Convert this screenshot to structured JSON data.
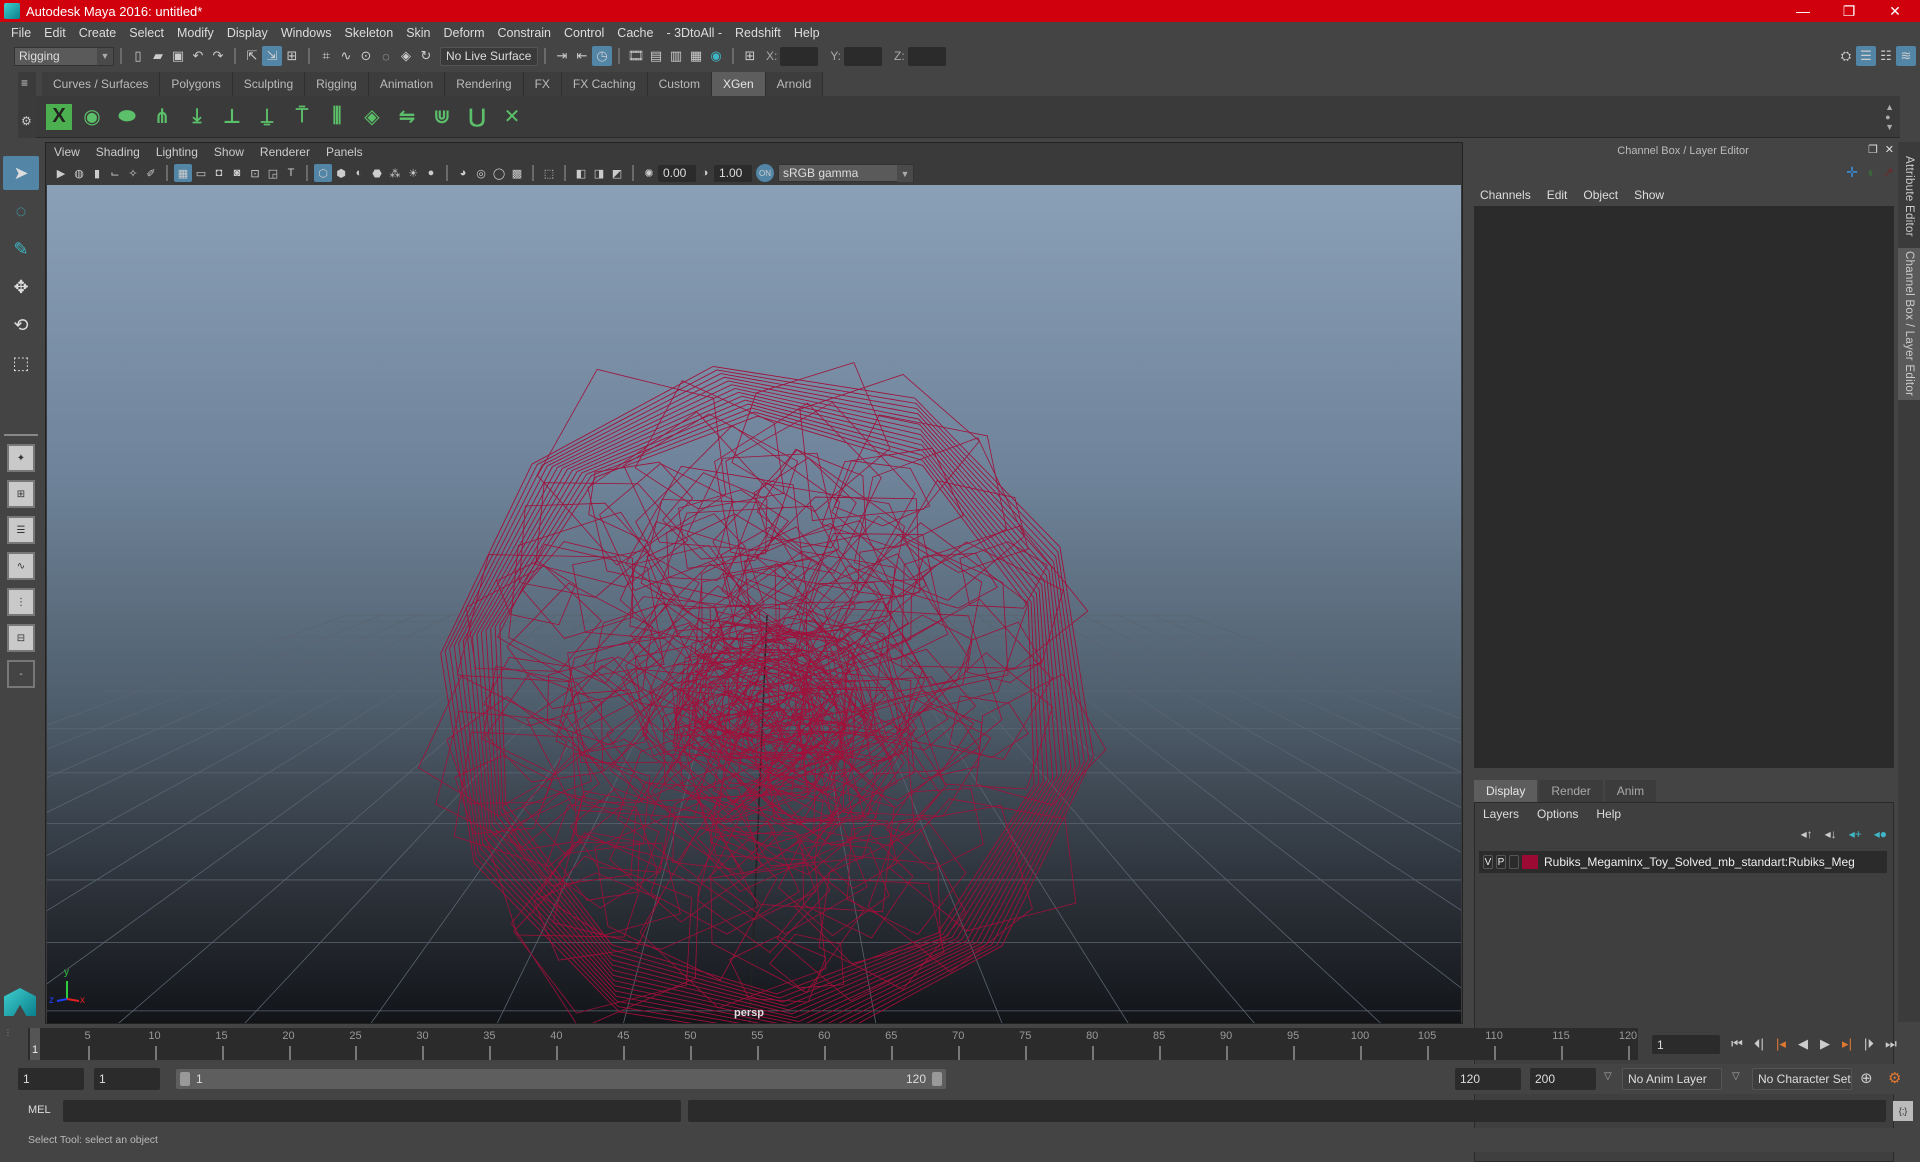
{
  "window": {
    "title": "Autodesk Maya 2016: untitled*",
    "minimize": "—",
    "restore": "❐",
    "close": "✕"
  },
  "menubar": [
    "File",
    "Edit",
    "Create",
    "Select",
    "Modify",
    "Display",
    "Windows",
    "Skeleton",
    "Skin",
    "Deform",
    "Constrain",
    "Control",
    "Cache",
    "- 3DtoAll -",
    "Redshift",
    "Help"
  ],
  "statusline": {
    "menuset": "Rigging",
    "live_surface": "No Live Surface",
    "x_label": "X:",
    "y_label": "Y:",
    "z_label": "Z:",
    "x_value": "",
    "y_value": "",
    "z_value": ""
  },
  "shelf": {
    "tabs": [
      "Curves / Surfaces",
      "Polygons",
      "Sculpting",
      "Rigging",
      "Animation",
      "Rendering",
      "FX",
      "FX Caching",
      "Custom",
      "XGen",
      "Arnold"
    ],
    "active_tab": "XGen",
    "icons": [
      "xgen-editor-icon",
      "xgen-preview-icon",
      "xgen-clear-icon",
      "add-guide-icon",
      "sculpt-guide-icon",
      "bake-guide-icon",
      "plant-guide-icon",
      "lock-guide-icon",
      "select-guides-icon",
      "interactive-groom-icon",
      "flip-guides-icon",
      "groom-select-icon",
      "groom-brush-icon",
      "delete-groom-icon"
    ]
  },
  "viewport": {
    "menu": [
      "View",
      "Shading",
      "Lighting",
      "Show",
      "Renderer",
      "Panels"
    ],
    "exposure": "0.00",
    "gamma": "1.00",
    "color_space": "sRGB gamma",
    "camera_label": "persp",
    "axis": {
      "x": "x",
      "y": "y",
      "z": "z"
    },
    "wire_color": "#a0103a"
  },
  "channel_box": {
    "title": "Channel Box / Layer Editor",
    "menu": [
      "Channels",
      "Edit",
      "Object",
      "Show"
    ]
  },
  "layer_editor": {
    "tabs": [
      "Display",
      "Render",
      "Anim"
    ],
    "active_tab": "Display",
    "menu": [
      "Layers",
      "Options",
      "Help"
    ],
    "layers": [
      {
        "v": "V",
        "p": "P",
        "color": "#9b0a32",
        "name": "Rubiks_Megaminx_Toy_Solved_mb_standart:Rubiks_Meg"
      }
    ]
  },
  "side_tabs": [
    "Attribute Editor",
    "Channel Box / Layer Editor"
  ],
  "timeline": {
    "start": 1,
    "end": 120,
    "major_step": 5,
    "current_frame": "1",
    "labels": [
      "5",
      "10",
      "15",
      "20",
      "25",
      "30",
      "35",
      "40",
      "45",
      "50",
      "55",
      "60",
      "65",
      "70",
      "75",
      "80",
      "85",
      "90",
      "95",
      "100",
      "105",
      "110",
      "115",
      "120"
    ]
  },
  "range": {
    "start_time": "1",
    "playback_start": "1",
    "slider_start": "1",
    "slider_end": "120",
    "playback_end": "120",
    "end_time": "200",
    "anim_layer": "No Anim Layer",
    "character_set": "No Character Set"
  },
  "command_line": {
    "label": "MEL",
    "value": "",
    "result": ""
  },
  "help_line": "Select Tool: select an object"
}
